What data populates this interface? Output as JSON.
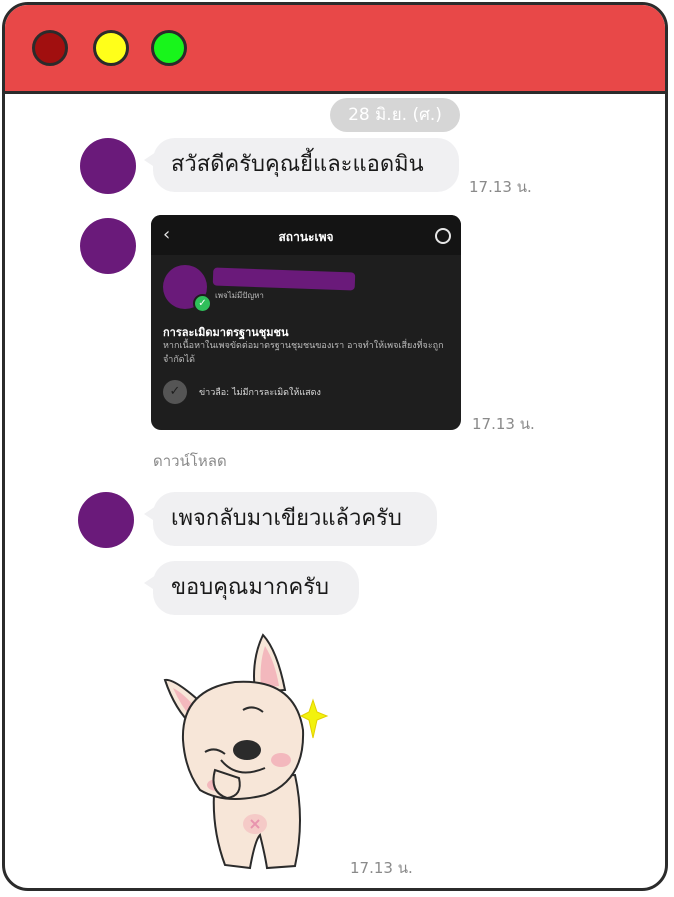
{
  "window": {
    "controls": [
      {
        "name": "close",
        "color": "#a10f0f"
      },
      {
        "name": "minimize",
        "color": "#ffff1a"
      },
      {
        "name": "maximize",
        "color": "#18f51b"
      }
    ],
    "titlebar_color": "#e84848"
  },
  "chat": {
    "date": "28 มิ.ย. (ศ.)",
    "messages": [
      {
        "text": "สวัสดีครับคุณยี้และแอดมิน",
        "time": "17.13 น."
      },
      {
        "type": "image",
        "time": "17.13 น.",
        "download_label": "ดาวน์โหลด"
      },
      {
        "text": "เพจกลับมาเขียวแล้วครับ"
      },
      {
        "text": "ขอบคุณมากครับ"
      },
      {
        "type": "sticker",
        "time": "17.13 น."
      }
    ],
    "avatar_color": "#6a1a7a"
  },
  "screenshot": {
    "title": "สถานะเพจ",
    "status": "เพจไม่มีปัญหา",
    "heading": "การละเมิดมาตรฐานชุมชน",
    "body": "หากเนื้อหาในเพจขัดต่อมาตรฐานชุมชนของเรา อาจทำให้เพจเสี่ยงที่จะถูกจำกัดได้",
    "row": "ข่าวลือ: ไม่มีการละเมิดให้แสดง"
  }
}
